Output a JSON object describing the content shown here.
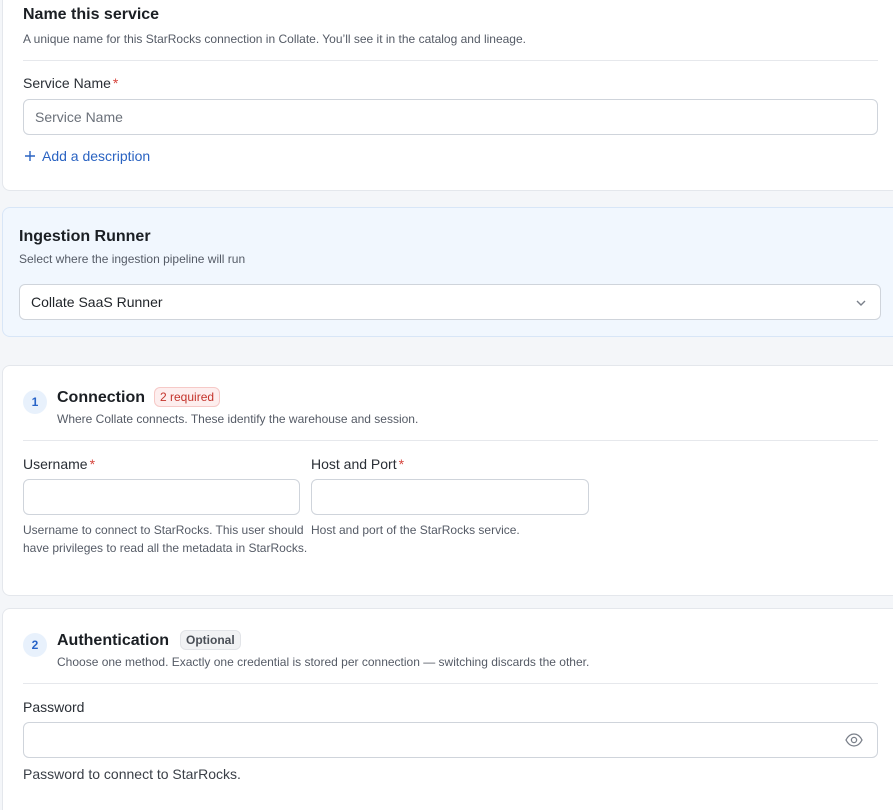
{
  "name_section": {
    "title": "Name this service",
    "subtitle": "A unique name for this StarRocks connection in Collate. You’ll see it in the catalog and lineage.",
    "service_name_label": "Service Name",
    "required_mark": "*",
    "service_name_placeholder": "Service Name",
    "service_name_value": "",
    "add_description_label": "Add a description",
    "plus_icon": "plus-icon"
  },
  "runner_section": {
    "title": "Ingestion Runner",
    "subtitle": "Select where the ingestion pipeline will run",
    "selected_runner": "Collate SaaS Runner",
    "chevron_icon": "chevron-down-icon"
  },
  "connection_section": {
    "step_number": "1",
    "title": "Connection",
    "badge": "2 required",
    "subtitle": "Where Collate connects. These identify the warehouse and session.",
    "username_label": "Username",
    "username_value": "",
    "username_help": "Username to connect to StarRocks. This user should have privileges to read all the metadata in StarRocks.",
    "host_port_label": "Host and Port",
    "host_port_value": "",
    "host_port_help": "Host and port of the StarRocks service."
  },
  "auth_section": {
    "step_number": "2",
    "title": "Authentication",
    "badge": "Optional",
    "subtitle": "Choose one method. Exactly one credential is stored per connection — switching discards the other.",
    "password_label": "Password",
    "password_value": "",
    "password_help": "Password to connect to StarRocks.",
    "eye_icon": "eye-icon"
  },
  "colors": {
    "accent": "#2a63c2",
    "required": "#d6453d",
    "runner_bg": "#f1f7fe"
  }
}
